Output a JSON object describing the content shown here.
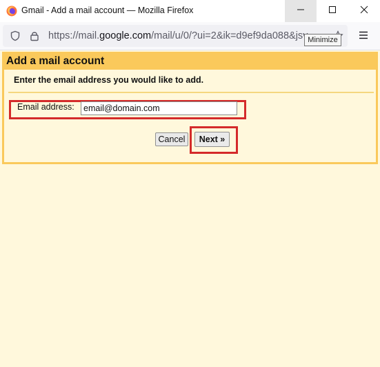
{
  "window": {
    "title": "Gmail - Add a mail account — Mozilla Firefox",
    "tooltip": "Minimize"
  },
  "toolbar": {
    "url_prefix": "https://mail.",
    "url_host": "google.com",
    "url_rest": "/mail/u/0/?ui=2&ik=d9ef9da088&jsv"
  },
  "dialog": {
    "title": "Add a mail account",
    "instruction": "Enter the email address you would like to add.",
    "email_label": "Email address:",
    "email_value": "email@domain.com",
    "cancel_label": "Cancel",
    "next_label": "Next »"
  },
  "colors": {
    "dialog_border": "#fac95b",
    "page_background": "#fff8dc",
    "highlight": "#d42a2a"
  },
  "icons": [
    "firefox-logo-icon",
    "minimize-icon",
    "maximize-icon",
    "close-icon",
    "shield-icon",
    "lock-icon",
    "star-icon",
    "hamburger-menu-icon"
  ]
}
